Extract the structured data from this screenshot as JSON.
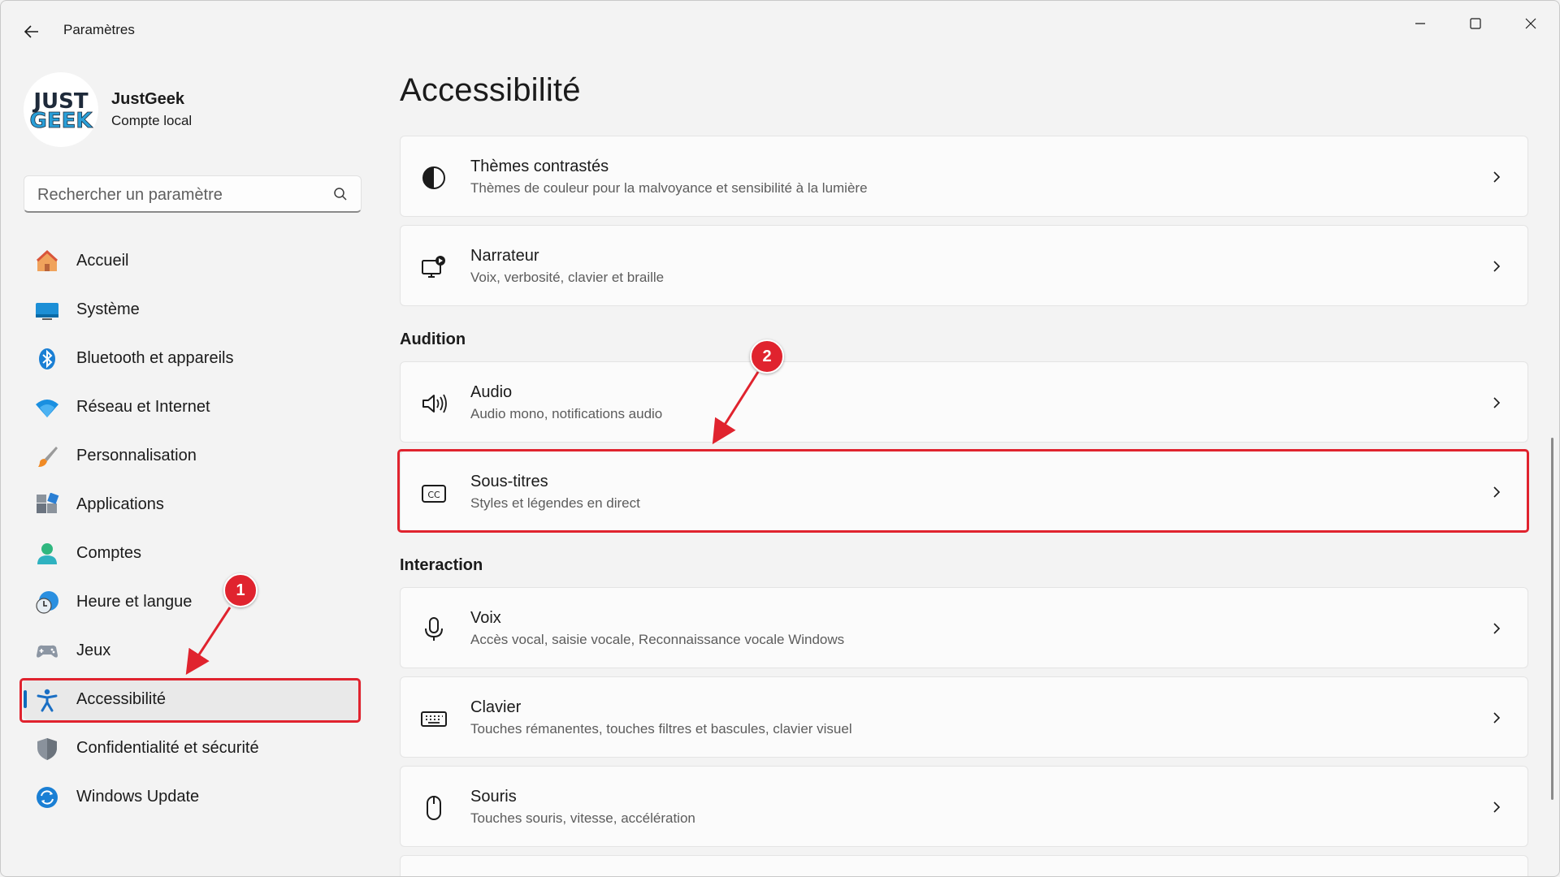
{
  "window": {
    "title": "Paramètres"
  },
  "profile": {
    "logo_text_top": "JUST",
    "logo_text_bottom": "GEEK",
    "name": "JustGeek",
    "account_type": "Compte local"
  },
  "search": {
    "placeholder": "Rechercher un paramètre"
  },
  "nav": {
    "items": [
      {
        "label": "Accueil",
        "icon": "home-icon"
      },
      {
        "label": "Système",
        "icon": "monitor-icon"
      },
      {
        "label": "Bluetooth et appareils",
        "icon": "bluetooth-icon"
      },
      {
        "label": "Réseau et Internet",
        "icon": "wifi-icon"
      },
      {
        "label": "Personnalisation",
        "icon": "brush-icon"
      },
      {
        "label": "Applications",
        "icon": "apps-icon"
      },
      {
        "label": "Comptes",
        "icon": "person-icon"
      },
      {
        "label": "Heure et langue",
        "icon": "clock-globe-icon"
      },
      {
        "label": "Jeux",
        "icon": "gamepad-icon"
      },
      {
        "label": "Accessibilité",
        "icon": "accessibility-icon",
        "selected": true
      },
      {
        "label": "Confidentialité et sécurité",
        "icon": "shield-icon"
      },
      {
        "label": "Windows Update",
        "icon": "update-icon"
      }
    ]
  },
  "main": {
    "title": "Accessibilité",
    "top_cards": [
      {
        "title": "Thèmes contrastés",
        "description": "Thèmes de couleur pour la malvoyance et sensibilité à la lumière",
        "icon": "contrast-icon"
      },
      {
        "title": "Narrateur",
        "description": "Voix, verbosité, clavier et braille",
        "icon": "narrator-icon"
      }
    ],
    "sections": [
      {
        "header": "Audition",
        "cards": [
          {
            "title": "Audio",
            "description": "Audio mono, notifications audio",
            "icon": "speaker-icon"
          },
          {
            "title": "Sous-titres",
            "description": "Styles et légendes en direct",
            "icon": "closed-captions-icon",
            "highlighted": true
          }
        ]
      },
      {
        "header": "Interaction",
        "cards": [
          {
            "title": "Voix",
            "description": "Accès vocal, saisie vocale, Reconnaissance vocale Windows",
            "icon": "microphone-icon"
          },
          {
            "title": "Clavier",
            "description": "Touches rémanentes, touches filtres et bascules, clavier visuel",
            "icon": "keyboard-icon"
          },
          {
            "title": "Souris",
            "description": "Touches souris, vitesse, accélération",
            "icon": "mouse-icon"
          }
        ]
      }
    ]
  },
  "annotations": {
    "badge_1": "1",
    "badge_2": "2",
    "highlight_color": "#e0232e"
  },
  "colors": {
    "accent": "#0f6cbd",
    "background": "#f3f3f3",
    "card": "#fbfbfb"
  }
}
